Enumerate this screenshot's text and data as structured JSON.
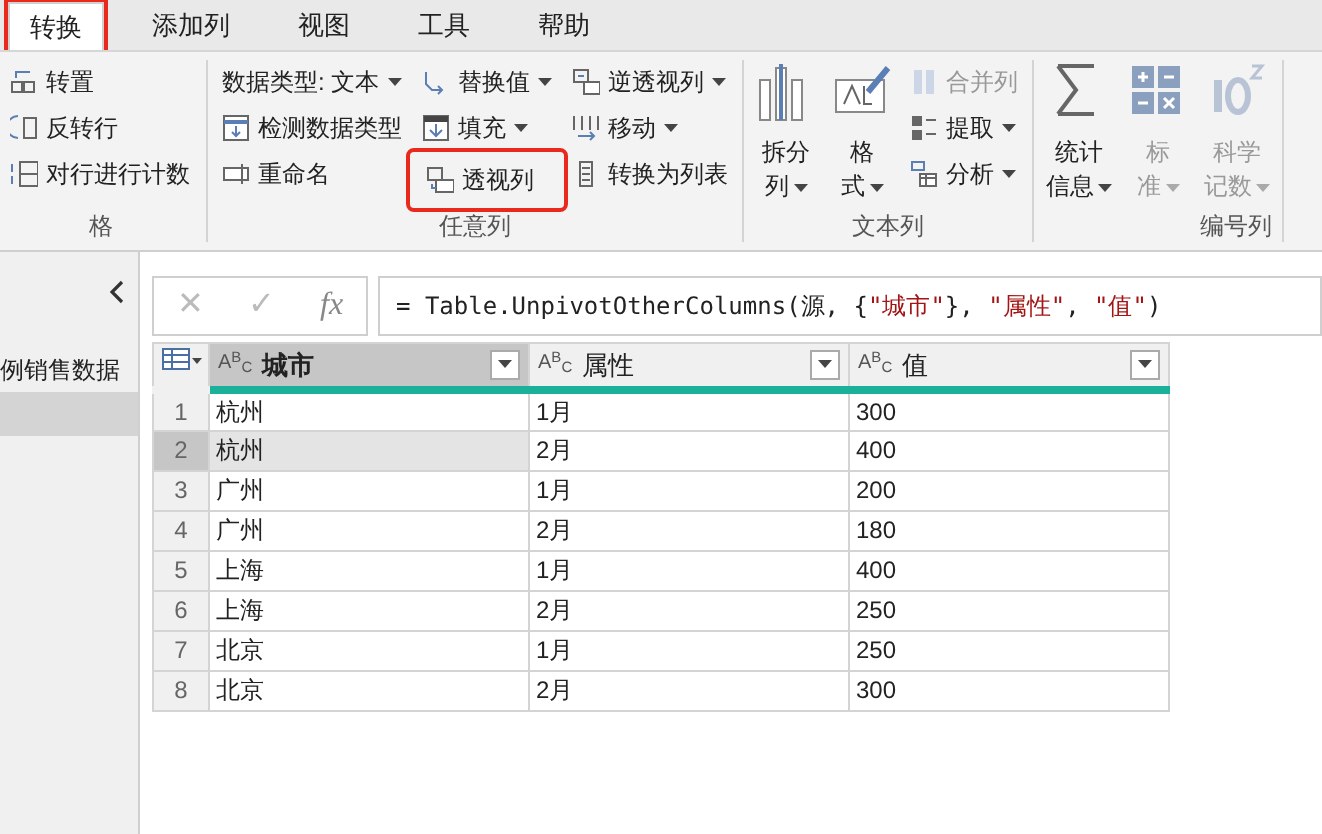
{
  "tabs": [
    {
      "label": "转换",
      "selected": true,
      "highlighted": true
    },
    {
      "label": "添加列",
      "selected": false,
      "highlighted": false
    },
    {
      "label": "视图",
      "selected": false,
      "highlighted": false
    },
    {
      "label": "工具",
      "selected": false,
      "highlighted": false
    },
    {
      "label": "帮助",
      "selected": false,
      "highlighted": false
    }
  ],
  "ribbon": {
    "groups": [
      {
        "label": "格",
        "columns": [
          [
            {
              "kind": "small",
              "label": "转置",
              "dropdown": false,
              "disabled": false,
              "highlighted": false
            },
            {
              "kind": "small",
              "label": "反转行",
              "dropdown": false,
              "disabled": false,
              "highlighted": false
            },
            {
              "kind": "small",
              "label": "对行进行计数",
              "dropdown": false,
              "disabled": false,
              "highlighted": false
            }
          ]
        ]
      },
      {
        "label": "任意列",
        "columns": [
          [
            {
              "kind": "small",
              "label": "数据类型: 文本",
              "dropdown": true,
              "disabled": false,
              "highlighted": false
            },
            {
              "kind": "small",
              "label": "检测数据类型",
              "dropdown": false,
              "disabled": false,
              "highlighted": false
            },
            {
              "kind": "small",
              "label": "重命名",
              "dropdown": false,
              "disabled": false,
              "highlighted": false
            }
          ],
          [
            {
              "kind": "small",
              "label": "替换值",
              "dropdown": true,
              "disabled": false,
              "highlighted": false
            },
            {
              "kind": "small",
              "label": "填充",
              "dropdown": true,
              "disabled": false,
              "highlighted": false
            },
            {
              "kind": "small",
              "label": "透视列",
              "dropdown": false,
              "disabled": false,
              "highlighted": true
            }
          ],
          [
            {
              "kind": "small",
              "label": "逆透视列",
              "dropdown": true,
              "disabled": false,
              "highlighted": false
            },
            {
              "kind": "small",
              "label": "移动",
              "dropdown": true,
              "disabled": false,
              "highlighted": false
            },
            {
              "kind": "small",
              "label": "转换为列表",
              "dropdown": false,
              "disabled": false,
              "highlighted": false
            }
          ]
        ]
      },
      {
        "label": "文本列",
        "columns": [
          [
            {
              "kind": "large",
              "label": "拆分列",
              "dropdown": true,
              "disabled": false,
              "highlighted": false
            }
          ],
          [
            {
              "kind": "large",
              "label": "格式",
              "dropdown": true,
              "disabled": false,
              "highlighted": false
            }
          ],
          [
            {
              "kind": "small",
              "label": "合并列",
              "dropdown": false,
              "disabled": true,
              "highlighted": false
            },
            {
              "kind": "small",
              "label": "提取",
              "dropdown": true,
              "disabled": false,
              "highlighted": false
            },
            {
              "kind": "small",
              "label": "分析",
              "dropdown": true,
              "disabled": false,
              "highlighted": false
            }
          ]
        ]
      },
      {
        "label": "编号列",
        "columns": [
          [
            {
              "kind": "large",
              "label": "统计信息",
              "dropdown": true,
              "disabled": false,
              "highlighted": false
            }
          ],
          [
            {
              "kind": "large",
              "label": "标准",
              "dropdown": true,
              "disabled": true,
              "highlighted": false
            }
          ],
          [
            {
              "kind": "large",
              "label": "科学记数",
              "dropdown": true,
              "disabled": true,
              "highlighted": false
            }
          ]
        ]
      }
    ]
  },
  "queries": [
    {
      "label": "例销售数据",
      "selected": false
    },
    {
      "selected": true
    }
  ],
  "formula_bar": {
    "cancel": "✕",
    "confirm": "✓",
    "fx": "fx",
    "tokens": [
      {
        "kind": "plain",
        "text": "= Table.UnpivotOtherColumns(源, {"
      },
      {
        "kind": "string",
        "text": "\"城市\""
      },
      {
        "kind": "plain",
        "text": "}, "
      },
      {
        "kind": "string",
        "text": "\"属性\""
      },
      {
        "kind": "plain",
        "text": ", "
      },
      {
        "kind": "string",
        "text": "\"值\""
      },
      {
        "kind": "plain",
        "text": ")"
      }
    ]
  },
  "table": {
    "columns": [
      {
        "type": "A$^{B}$$_{C}$",
        "label": "城市",
        "selected": true
      },
      {
        "type": "A$^{B}$$_{C}$",
        "label": "属性",
        "selected": false
      },
      {
        "type": "A$^{B}$$_{C}$",
        "label": "值",
        "selected": false
      }
    ],
    "rows": [
      {
        "n": "1",
        "cells": [
          "杭州",
          "1月",
          "300"
        ],
        "selected": false
      },
      {
        "n": "2",
        "cells": [
          "杭州",
          "2月",
          "400"
        ],
        "selected": true
      },
      {
        "n": "3",
        "cells": [
          "广州",
          "1月",
          "200"
        ],
        "selected": false
      },
      {
        "n": "4",
        "cells": [
          "广州",
          "2月",
          "180"
        ],
        "selected": false
      },
      {
        "n": "5",
        "cells": [
          "上海",
          "1月",
          "400"
        ],
        "selected": false
      },
      {
        "n": "6",
        "cells": [
          "上海",
          "2月",
          "250"
        ],
        "selected": false
      },
      {
        "n": "7",
        "cells": [
          "北京",
          "1月",
          "250"
        ],
        "selected": false
      },
      {
        "n": "8",
        "cells": [
          "北京",
          "2月",
          "300"
        ],
        "selected": false
      }
    ]
  }
}
